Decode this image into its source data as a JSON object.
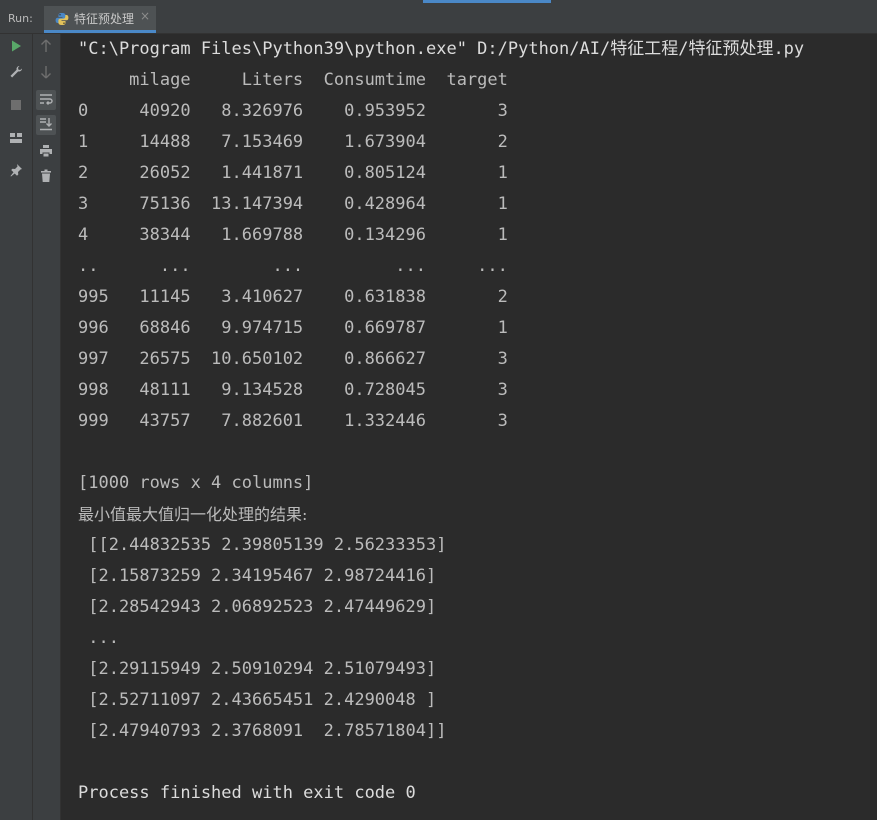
{
  "run_panel": {
    "label": "Run:",
    "tab_title": "特征预处理",
    "tab_close": "×"
  },
  "toolbar": {
    "buttons": [
      {
        "icon": "play-icon",
        "color": "#59a869"
      },
      {
        "icon": "wrench-icon",
        "color": "#afb1b3"
      },
      {
        "icon": "stop-icon",
        "color": "#6e6e6e"
      },
      {
        "icon": "layout-icon",
        "color": "#afb1b3"
      },
      {
        "icon": "pin-icon",
        "color": "#afb1b3"
      },
      {
        "icon": "arrow-up-icon",
        "color": "#6e6e6e"
      },
      {
        "icon": "arrow-down-icon",
        "color": "#6e6e6e"
      },
      {
        "icon": "soft-wrap-icon",
        "color": "#afb1b3"
      },
      {
        "icon": "scroll-to-end-icon",
        "color": "#afb1b3"
      },
      {
        "icon": "print-icon",
        "color": "#afb1b3"
      },
      {
        "icon": "trash-icon",
        "color": "#afb1b3"
      }
    ]
  },
  "console": {
    "lines": [
      "\"C:\\Program Files\\Python39\\python.exe\" D:/Python/AI/特征工程/特征预处理.py",
      "     milage     Liters  Consumtime  target",
      "0     40920   8.326976    0.953952       3",
      "1     14488   7.153469    1.673904       2",
      "2     26052   1.441871    0.805124       1",
      "3     75136  13.147394    0.428964       1",
      "4     38344   1.669788    0.134296       1",
      "..      ...        ...         ...     ...",
      "995   11145   3.410627    0.631838       2",
      "996   68846   9.974715    0.669787       1",
      "997   26575  10.650102    0.866627       3",
      "998   48111   9.134528    0.728045       3",
      "999   43757   7.882601    1.332446       3",
      "",
      "[1000 rows x 4 columns]",
      "最小值最大值归一化处理的结果:",
      " [[2.44832535 2.39805139 2.56233353]",
      " [2.15873259 2.34195467 2.98724416]",
      " [2.28542943 2.06892523 2.47449629]",
      " ...",
      " [2.29115949 2.50910294 2.51079493]",
      " [2.52711097 2.43665451 2.4290048 ]",
      " [2.47940793 2.3768091  2.78571804]]",
      "",
      "Process finished with exit code 0"
    ]
  }
}
